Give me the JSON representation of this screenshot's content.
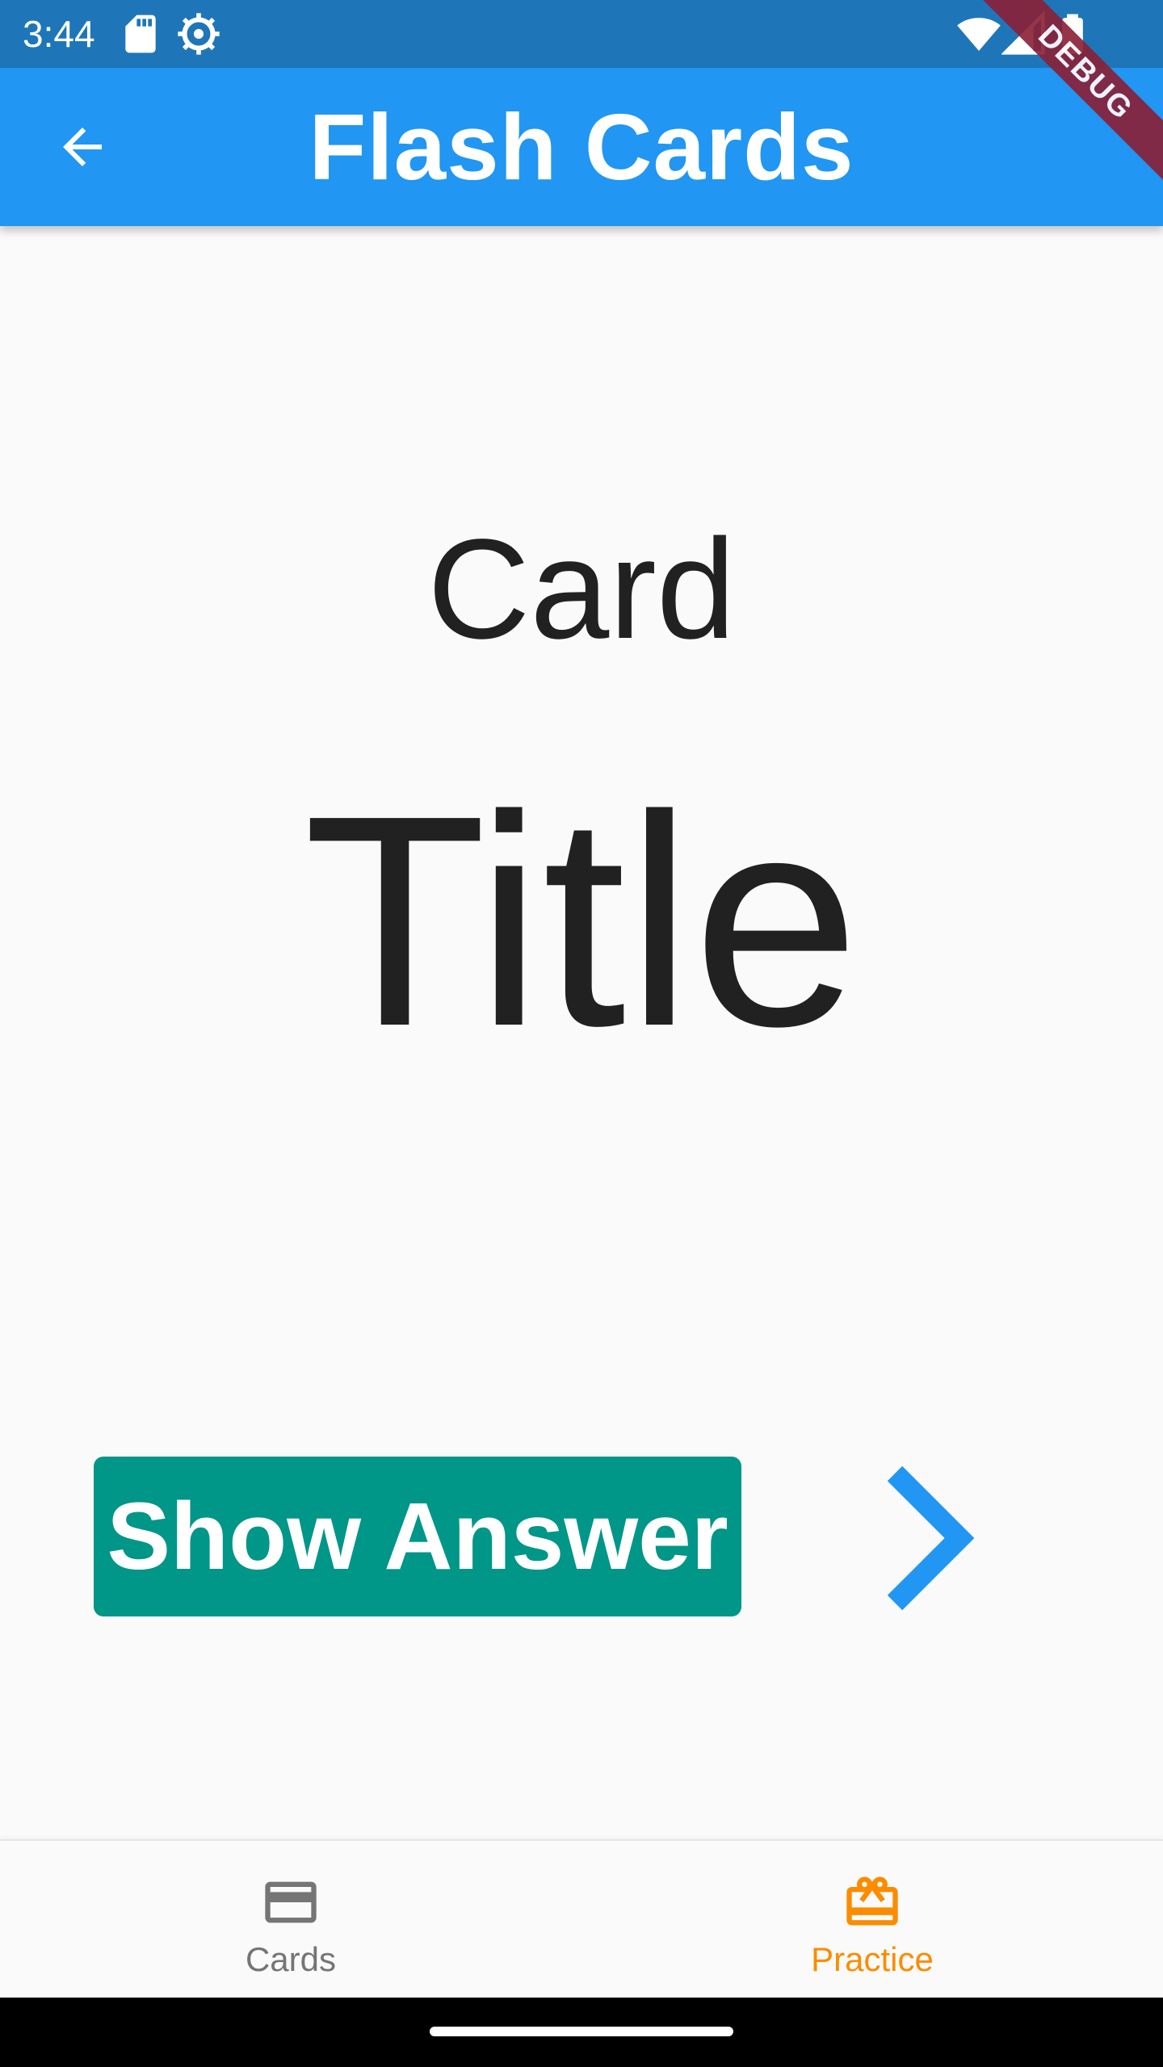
{
  "status_bar": {
    "time": "3:44",
    "icons": [
      "sd-card-icon",
      "settings-icon",
      "wifi-icon",
      "cell-signal-icon",
      "battery-icon"
    ],
    "background_color": "#1e76b9"
  },
  "app_bar": {
    "title": "Flash Cards",
    "back_icon": "arrow-back-icon",
    "background_color": "#2196f3"
  },
  "debug_banner": {
    "label": "DEBUG"
  },
  "card": {
    "label": "Card",
    "title": "Title"
  },
  "actions": {
    "show_answer_label": "Show Answer",
    "show_answer_color": "#009688",
    "next_icon": "chevron-right-icon",
    "next_color": "#2196f3"
  },
  "bottom_nav": {
    "items": [
      {
        "label": "Cards",
        "icon": "credit-card-icon",
        "active": false,
        "color": "#757575"
      },
      {
        "label": "Practice",
        "icon": "card-giftcard-icon",
        "active": true,
        "color": "#fb8c00"
      }
    ]
  }
}
